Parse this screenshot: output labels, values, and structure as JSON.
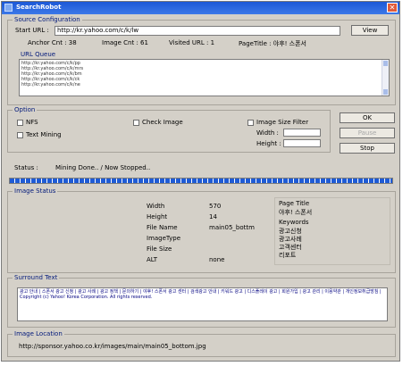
{
  "window": {
    "title": "SearchRobot"
  },
  "source": {
    "group_label": "Source Configuration",
    "start_url_label": "Start URL :",
    "start_url_value": "http://kr.yahoo.com/c/k/lw",
    "view_label": "View",
    "anchor_cnt": "Anchor Cnt : 38",
    "image_cnt": "Image Cnt : 61",
    "visited_url": "Visited URL : 1",
    "page_title": "PageTitle : 야후! 스폰서",
    "url_queue_label": "URL Queue",
    "url_queue_items": [
      "http://kr.yahoo.com/c/k/pp",
      "http://kr.yahoo.com/c/k/mrs",
      "http://kr.yahoo.com/c/k/bm",
      "http://kr.yahoo.com/c/k/ck",
      "http://kr.yahoo.com/c/k/ne"
    ]
  },
  "option": {
    "group_label": "Option",
    "nfs_label": "NFS",
    "text_mining_label": "Text Mining",
    "check_image_label": "Check Image",
    "image_size_filter_label": "Image Size Filter",
    "width_label": "Width :",
    "height_label": "Height :"
  },
  "buttons": {
    "ok": "OK",
    "middle": "Pause",
    "stop": "Stop"
  },
  "status": {
    "label": "Status :",
    "value": "Mining Done.. / Now Stopped.."
  },
  "progress": {
    "value": 1.0
  },
  "image_status": {
    "group_label": "Image Status",
    "props": [
      {
        "label": "Width",
        "value": "570"
      },
      {
        "label": "Height",
        "value": "14"
      },
      {
        "label": "File Name",
        "value": "main05_bottm"
      },
      {
        "label": "ImageType",
        "value": ""
      },
      {
        "label": "File Size",
        "value": ""
      },
      {
        "label": "ALT",
        "value": "none"
      }
    ],
    "page_title_label": "Page Title",
    "page_title_value": "야후! 스폰서",
    "keywords_label": "Keywords",
    "keywords": [
      "광고신청",
      "광고사례",
      "고객센터",
      "리포트"
    ]
  },
  "surround": {
    "group_label": "Surround Text",
    "text": "광고 안내 | 스폰서 광고 신청 | 광고 사례 | 광고 정책 | 문의하기 | 야후! 스폰서 광고 센터 | 검색광고 안내 | 키워드 광고 | 디스플레이 광고 | 회원가입 | 광고 관리 | 이용약관 | 개인정보취급방침 | Copyright (c) Yahoo! Korea Corporation. All rights reserved."
  },
  "location": {
    "group_label": "Image Location",
    "value": "http://sponsor.yahoo.co.kr/images/main/main05_bottom.jpg"
  }
}
